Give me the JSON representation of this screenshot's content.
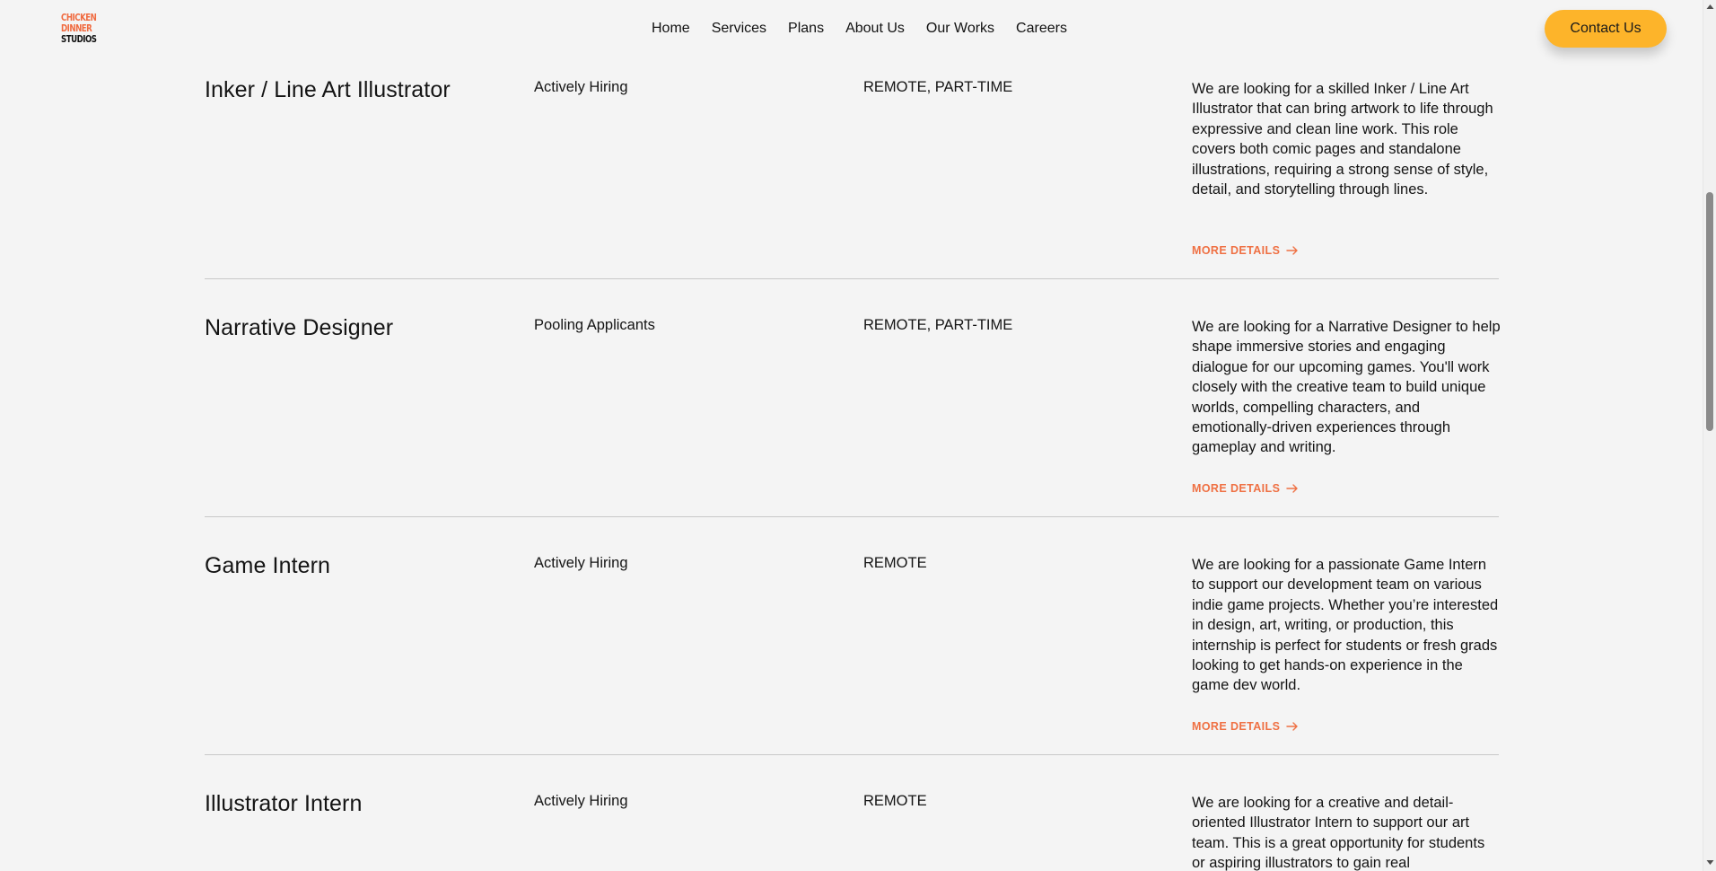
{
  "header": {
    "logo": {
      "line1": "CHICKEN",
      "line2": "DINNER",
      "line3": "STUDIOS",
      "colors": {
        "accent": "#f06a3f",
        "dark": "#111111"
      }
    },
    "nav": [
      "Home",
      "Services",
      "Plans",
      "About Us",
      "Our Works",
      "Careers"
    ],
    "contact_label": "Contact Us"
  },
  "jobs": [
    {
      "title": "Inker / Line Art Illustrator",
      "status": "Actively Hiring",
      "type": "REMOTE, PART-TIME",
      "description": "We are looking for a skilled Inker / Line Art Illustrator that can bring artwork to life through expressive and clean line work. This role covers both comic pages and standalone illustrations, requiring a strong sense of style, detail, and storytelling through lines.",
      "more_label": "MORE DETAILS"
    },
    {
      "title": "Narrative Designer",
      "status": "Pooling Applicants",
      "type": "REMOTE, PART-TIME",
      "description": "We are looking for a Narrative Designer to help shape immersive stories and engaging dialogue for our upcoming games. You'll work closely with the creative team to build unique worlds, compelling characters, and emotionally-driven experiences through gameplay and writing.",
      "more_label": "MORE DETAILS"
    },
    {
      "title": "Game Intern",
      "status": "Actively Hiring",
      "type": "REMOTE",
      "description": "We are looking for a passionate Game Intern to support our development team on various indie game projects. Whether you’re interested in design, art, writing, or production, this internship is perfect for students or fresh grads looking to get hands-on experience in the game dev world.",
      "more_label": "MORE DETAILS"
    },
    {
      "title": "Illustrator Intern",
      "status": "Actively Hiring",
      "type": "REMOTE",
      "description": "We are looking for a creative and detail-oriented Illustrator Intern to support our art team. This is a great opportunity for students or aspiring illustrators to gain real"
    }
  ],
  "colors": {
    "background": "#f4f4f4",
    "accent_orange": "#ef7043",
    "button_yellow": "#fdb42a",
    "divider": "#c8c8c8"
  },
  "icons": {
    "more_arrow": "arrow-right-icon",
    "scroll_up": "triangle-up-icon",
    "scroll_down": "triangle-down-icon"
  }
}
